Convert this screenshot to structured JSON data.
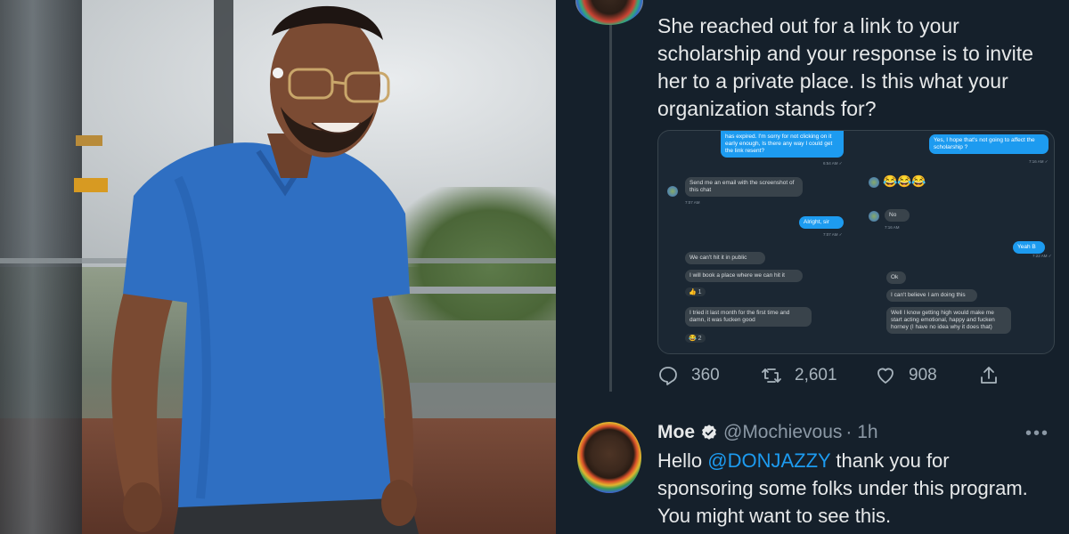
{
  "tweet": {
    "text": "She reached out for a link to your scholarship and your response is to invite her to a private place. Is this what your organization stands for?",
    "stats": {
      "replies": "360",
      "retweets": "2,601",
      "likes": "908"
    }
  },
  "chat_screenshot": {
    "messages": [
      {
        "text": "has expired. I'm sorry for not clicking on it early enough, Is there any way I could get the link resent?",
        "time": "6:54 AM ✓"
      },
      {
        "text": "Send me an email with the screenshot of this chat",
        "time": "7:07 AM"
      },
      {
        "text": "Alright, sir",
        "time": "7:07 AM ✓"
      },
      {
        "text": "We can't hit it in public"
      },
      {
        "text": "I will book a place where we can hit it"
      },
      {
        "text": "I tried it last month for the first time and damn, it was fucken good"
      },
      {
        "text": "Yes, I hope that's not going to affect the scholarship ?",
        "time": "7:16 AM ✓"
      },
      {
        "text": "😂😂😂"
      },
      {
        "text": "No",
        "time": "7:16 AM"
      },
      {
        "text": "Yeah B",
        "time": "7:22 AM ✓"
      },
      {
        "text": "Ok"
      },
      {
        "text": "I can't believe I am doing this"
      },
      {
        "text": "Well I know getting high would make me start acting emotional, happy and fucken horney (I have no idea why it does that)"
      }
    ],
    "reactions": {
      "thumbs_count": "1",
      "laugh_count": "2"
    }
  },
  "reply": {
    "name": "Moe",
    "handle": "@Mochievous",
    "time": "· 1h",
    "text_prefix": "Hello ",
    "mention": "@DONJAZZY",
    "text_suffix": " thank you for sponsoring some folks under this program. You might want to see this."
  },
  "icons": [
    "reply-icon",
    "retweet-icon",
    "like-icon",
    "share-icon",
    "verified-badge-icon",
    "more-options-icon"
  ],
  "colors": {
    "background": "#15202b",
    "accent": "#1d9bf0",
    "text": "#e7e9ea",
    "muted": "#8b98a5"
  }
}
